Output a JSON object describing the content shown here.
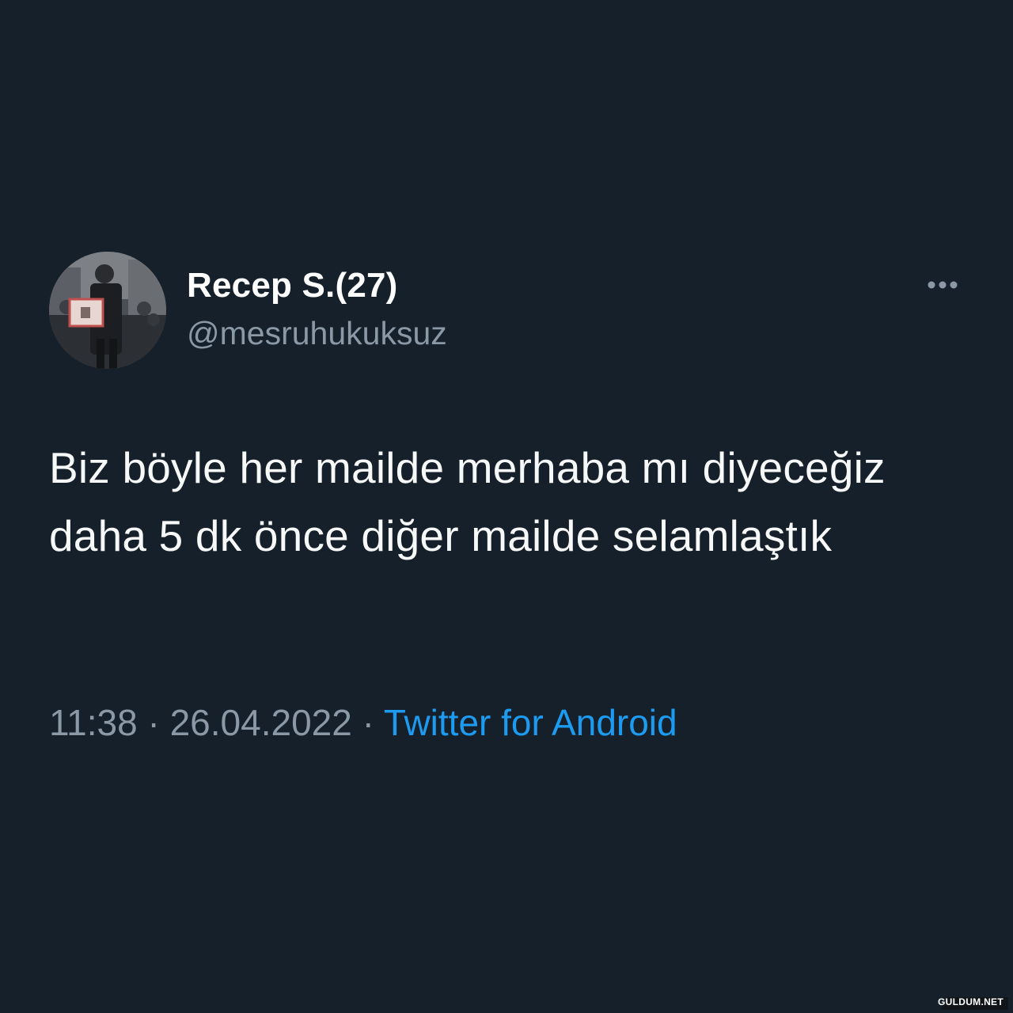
{
  "tweet": {
    "display_name": "Recep S.(27)",
    "handle": "@mesruhukuksuz",
    "text": "Biz böyle her mailde merhaba mı diyeceğiz daha 5 dk önce diğer mailde selamlaştık",
    "time": "11:38",
    "separator": " · ",
    "date": "26.04.2022",
    "source": "Twitter for Android"
  },
  "icons": {
    "more": "more-horizontal-icon",
    "avatar": "profile-photo"
  },
  "watermark": "GULDUM.NET",
  "colors": {
    "background": "#15202b",
    "text_primary": "#f7f9f9",
    "text_secondary": "#8b98a5",
    "accent": "#1d9bf0"
  }
}
